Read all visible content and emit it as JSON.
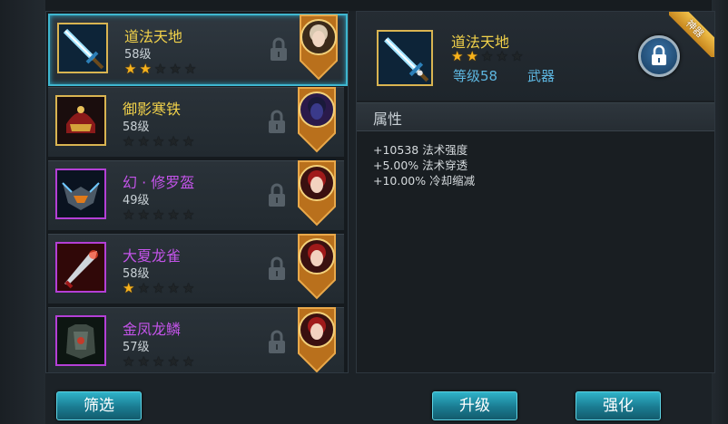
{
  "items": [
    {
      "name": "道法天地",
      "level": "58级",
      "stars": 2,
      "name_color": "#f2d24a",
      "frame": "gold",
      "icon": "sword-icon",
      "owner": "silver-hair-hero-portrait",
      "selected": true
    },
    {
      "name": "御影寒铁",
      "level": "58级",
      "stars": 0,
      "name_color": "#f2d24a",
      "frame": "gold",
      "icon": "helmet-icon",
      "owner": "dark-assassin-portrait",
      "selected": false
    },
    {
      "name": "幻 · 修罗盔",
      "level": "49级",
      "stars": 0,
      "name_color": "#c454ea",
      "frame": "purple",
      "icon": "horned-helm-icon",
      "owner": "red-girl-portrait",
      "selected": false
    },
    {
      "name": "大夏龙雀",
      "level": "58级",
      "stars": 1,
      "name_color": "#c454ea",
      "frame": "purple",
      "icon": "blade-icon",
      "owner": "red-girl-portrait",
      "selected": false
    },
    {
      "name": "金凤龙鳞",
      "level": "57级",
      "stars": 0,
      "name_color": "#c454ea",
      "frame": "purple",
      "icon": "armor-icon",
      "owner": "red-girl-portrait",
      "selected": false
    }
  ],
  "detail": {
    "name": "道法天地",
    "stars": 2,
    "level": "等级58",
    "type": "武器",
    "ribbon": "神器",
    "section_title": "属性",
    "attributes": [
      "+10538 法术强度",
      "+5.00% 法术穿透",
      "+10.00% 冷却缩减"
    ],
    "icon": "sword-icon",
    "lock": "lock-icon"
  },
  "buttons": {
    "filter": "筛选",
    "upgrade": "升级",
    "enhance": "强化"
  },
  "colors": {
    "accent": "#3fb6cf",
    "gold": "#f2d24a",
    "purple": "#c454ea",
    "blue_text": "#5db6e0",
    "star": "#f7b21c"
  }
}
